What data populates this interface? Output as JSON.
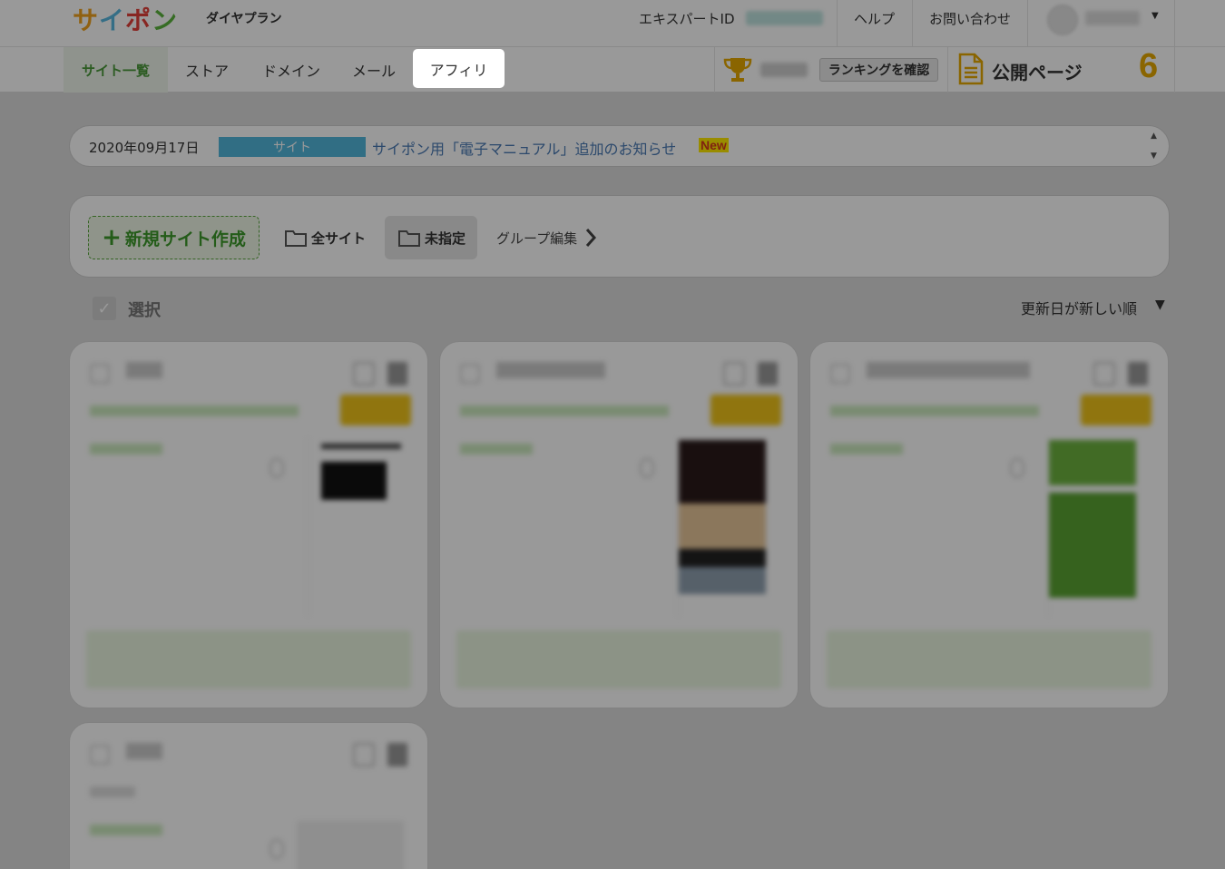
{
  "header": {
    "logo_chars": [
      {
        "char": "サ",
        "color": "#f0a21e"
      },
      {
        "char": "イ",
        "color": "#59b8e0"
      },
      {
        "char": "ポ",
        "color": "#e3403a"
      },
      {
        "char": "ン",
        "color": "#5bb43c"
      }
    ],
    "plan": "ダイヤプラン",
    "expert_id_label": "エキスパートID",
    "help": "ヘルプ",
    "contact": "お問い合わせ"
  },
  "nav": {
    "tabs": [
      {
        "label": "サイト一覧",
        "active": true
      },
      {
        "label": "ストア"
      },
      {
        "label": "ドメイン"
      },
      {
        "label": "メール"
      },
      {
        "label": "アフィリ",
        "highlighted": true
      }
    ],
    "ranking_button": "ランキングを確認",
    "public_pages_label": "公開ページ",
    "public_pages_count": "6"
  },
  "notice": {
    "date": "2020年09月17日",
    "category": "サイト",
    "category_color": "#52b7dc",
    "title": "サイポン用「電子マニュアル」追加のお知らせ",
    "badge": "New"
  },
  "toolbar": {
    "new_site": "新規サイト作成",
    "all_sites": "全サイト",
    "unassigned": "未指定",
    "group_edit": "グループ編集"
  },
  "list": {
    "select_label": "選択",
    "sort_label": "更新日が新しい順"
  },
  "colors": {
    "brand_green": "#4a9a3a",
    "accent_yellow": "#e6a800",
    "link_blue": "#4a7ab5"
  }
}
